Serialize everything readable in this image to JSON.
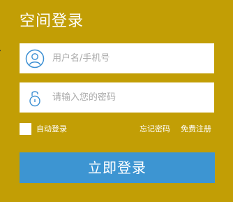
{
  "title": "空间登录",
  "username": {
    "placeholder": "用户名/手机号",
    "value": ""
  },
  "password": {
    "placeholder": "请输入您的密码",
    "value": ""
  },
  "remember": {
    "label": "自动登录",
    "checked": false
  },
  "links": {
    "forgot": "忘记密码",
    "register": "免费注册"
  },
  "login_button": "立即登录",
  "icons": {
    "user": "user-icon",
    "lock": "lock-icon"
  },
  "colors": {
    "background": "#c29e05",
    "button": "#3d95d2",
    "icon": "#3b8fd3"
  }
}
